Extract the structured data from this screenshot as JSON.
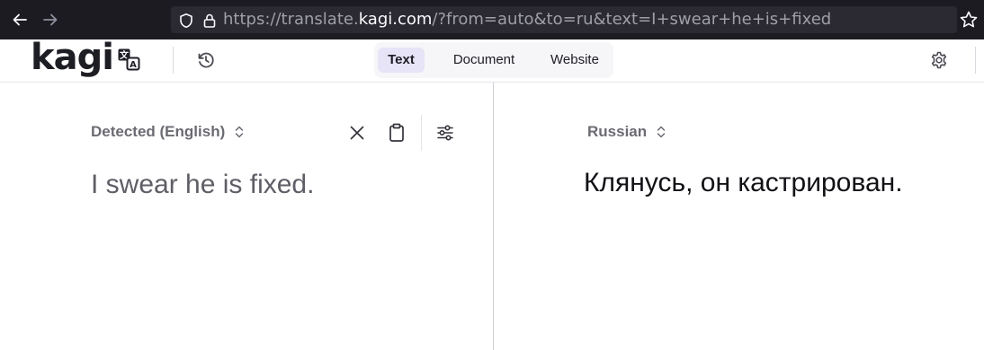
{
  "browser": {
    "url_prefix": "https://translate.",
    "url_domain": "kagi.com",
    "url_suffix": "/?from=auto&to=ru&text=I+swear+he+is+fixed"
  },
  "app": {
    "logo_text": "kagi",
    "tabs": [
      "Text",
      "Document",
      "Website"
    ],
    "active_tab": "Text"
  },
  "source": {
    "language": "Detected (English)",
    "text": "I swear he is fixed."
  },
  "target": {
    "language": "Russian",
    "text": "Клянусь, он кастрирован."
  },
  "colors": {
    "browser_bg": "#1c1b22",
    "urlbar_bg": "#2b2a33",
    "active_tab_bg": "#e7e4f7"
  },
  "icons": [
    "back-arrow-icon",
    "forward-arrow-icon",
    "shield-icon",
    "lock-icon",
    "star-icon",
    "translate-icon",
    "history-icon",
    "gear-icon",
    "chevron-updown-icon",
    "close-icon",
    "clipboard-icon",
    "sliders-icon"
  ]
}
